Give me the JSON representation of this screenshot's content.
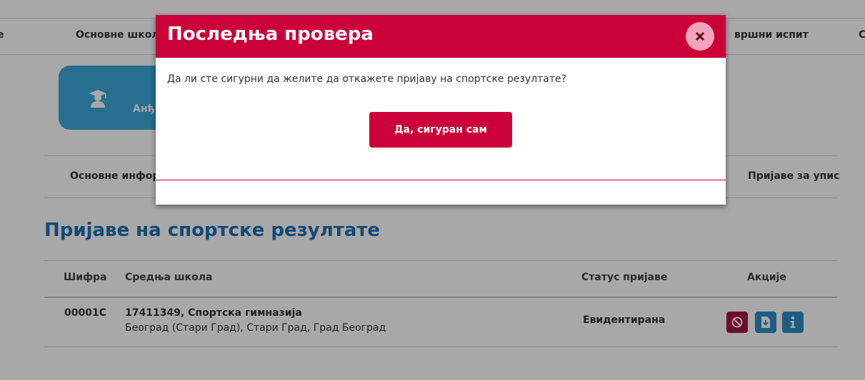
{
  "top_nav": {
    "items": [
      "е",
      "Основне школе",
      "вршни испит",
      "С"
    ]
  },
  "profile": {
    "icon": "student-icon",
    "name": "Анђ"
  },
  "sub_nav": {
    "items": [
      "Основне инфор",
      "Пријаве за упис"
    ]
  },
  "page": {
    "title": "Пријаве на спортске резултате"
  },
  "table": {
    "columns": [
      "Шифра",
      "Средња школа",
      "Статус пријаве",
      "Акције"
    ],
    "rows": [
      {
        "code": "00001С",
        "school_name": "17411349, Спортска гимназија",
        "school_location": "Београд (Стари Град), Стари Град, Град Београд",
        "status": "Евидентирана",
        "actions": [
          {
            "icon": "cancel-icon",
            "color": "#a31645"
          },
          {
            "icon": "download-icon",
            "color": "#2d8ec4"
          },
          {
            "icon": "info-icon",
            "color": "#2d8ec4"
          }
        ]
      }
    ]
  },
  "modal": {
    "title": "Последња провера",
    "message": "Да ли сте сигурни да желите да откажете пријаву на спортске резултате?",
    "confirm_label": "Да, сигуран сам",
    "close_icon": "close-icon"
  },
  "colors": {
    "brand_red": "#cc0039",
    "heading_blue": "#1c6fb5",
    "card_blue": "#3aa9dc"
  }
}
